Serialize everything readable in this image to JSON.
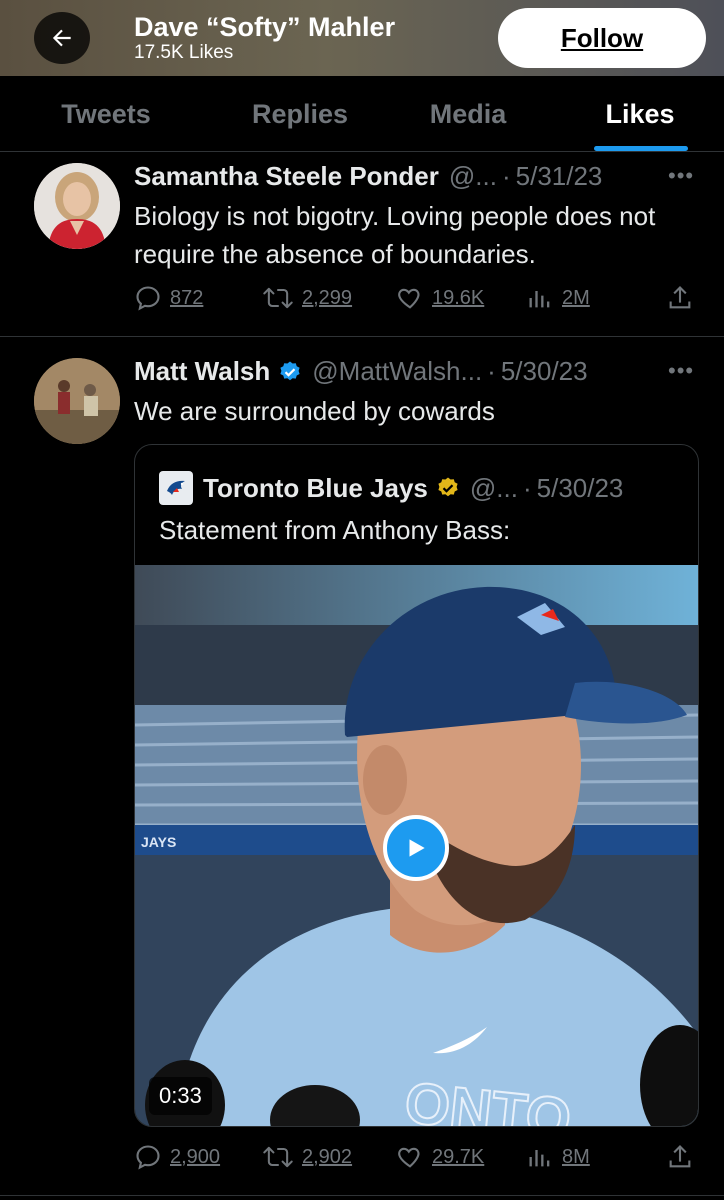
{
  "header": {
    "name": "Dave “Softy” Mahler",
    "subtitle": "17.5K Likes",
    "follow_label": "Follow"
  },
  "tabs": [
    {
      "label": "Tweets",
      "active": false
    },
    {
      "label": "Replies",
      "active": false
    },
    {
      "label": "Media",
      "active": false
    },
    {
      "label": "Likes",
      "active": true
    }
  ],
  "tweets": [
    {
      "name": "Samantha Steele Ponder",
      "handle": "@...",
      "date": "5/31/23",
      "verified": false,
      "text": "Biology is not bigotry. Loving people does not require the absence of boundaries.",
      "replies": "872",
      "retweets": "2,299",
      "likes": "19.6K",
      "views": "2M"
    },
    {
      "name": "Matt Walsh",
      "handle": "@MattWalsh...",
      "date": "5/30/23",
      "verified": true,
      "text": "We are surrounded by cowards",
      "replies": "2,900",
      "retweets": "2,902",
      "likes": "29.7K",
      "views": "8M",
      "quote": {
        "name": "Toronto Blue Jays",
        "handle": "@...",
        "date": "5/30/23",
        "verified_gold": true,
        "text": "Statement from Anthony Bass:",
        "video_duration": "0:33",
        "video_cap_text": "ONTO",
        "video_banner_text": "JAYS"
      }
    }
  ],
  "icons": {
    "back": "arrow-left-icon",
    "more": "more-icon",
    "reply": "reply-icon",
    "retweet": "retweet-icon",
    "like": "heart-icon",
    "views": "views-icon",
    "share": "share-icon",
    "play": "play-icon"
  },
  "colors": {
    "accent": "#1d9bf0",
    "muted": "#71767b",
    "gold": "#e2b719"
  }
}
